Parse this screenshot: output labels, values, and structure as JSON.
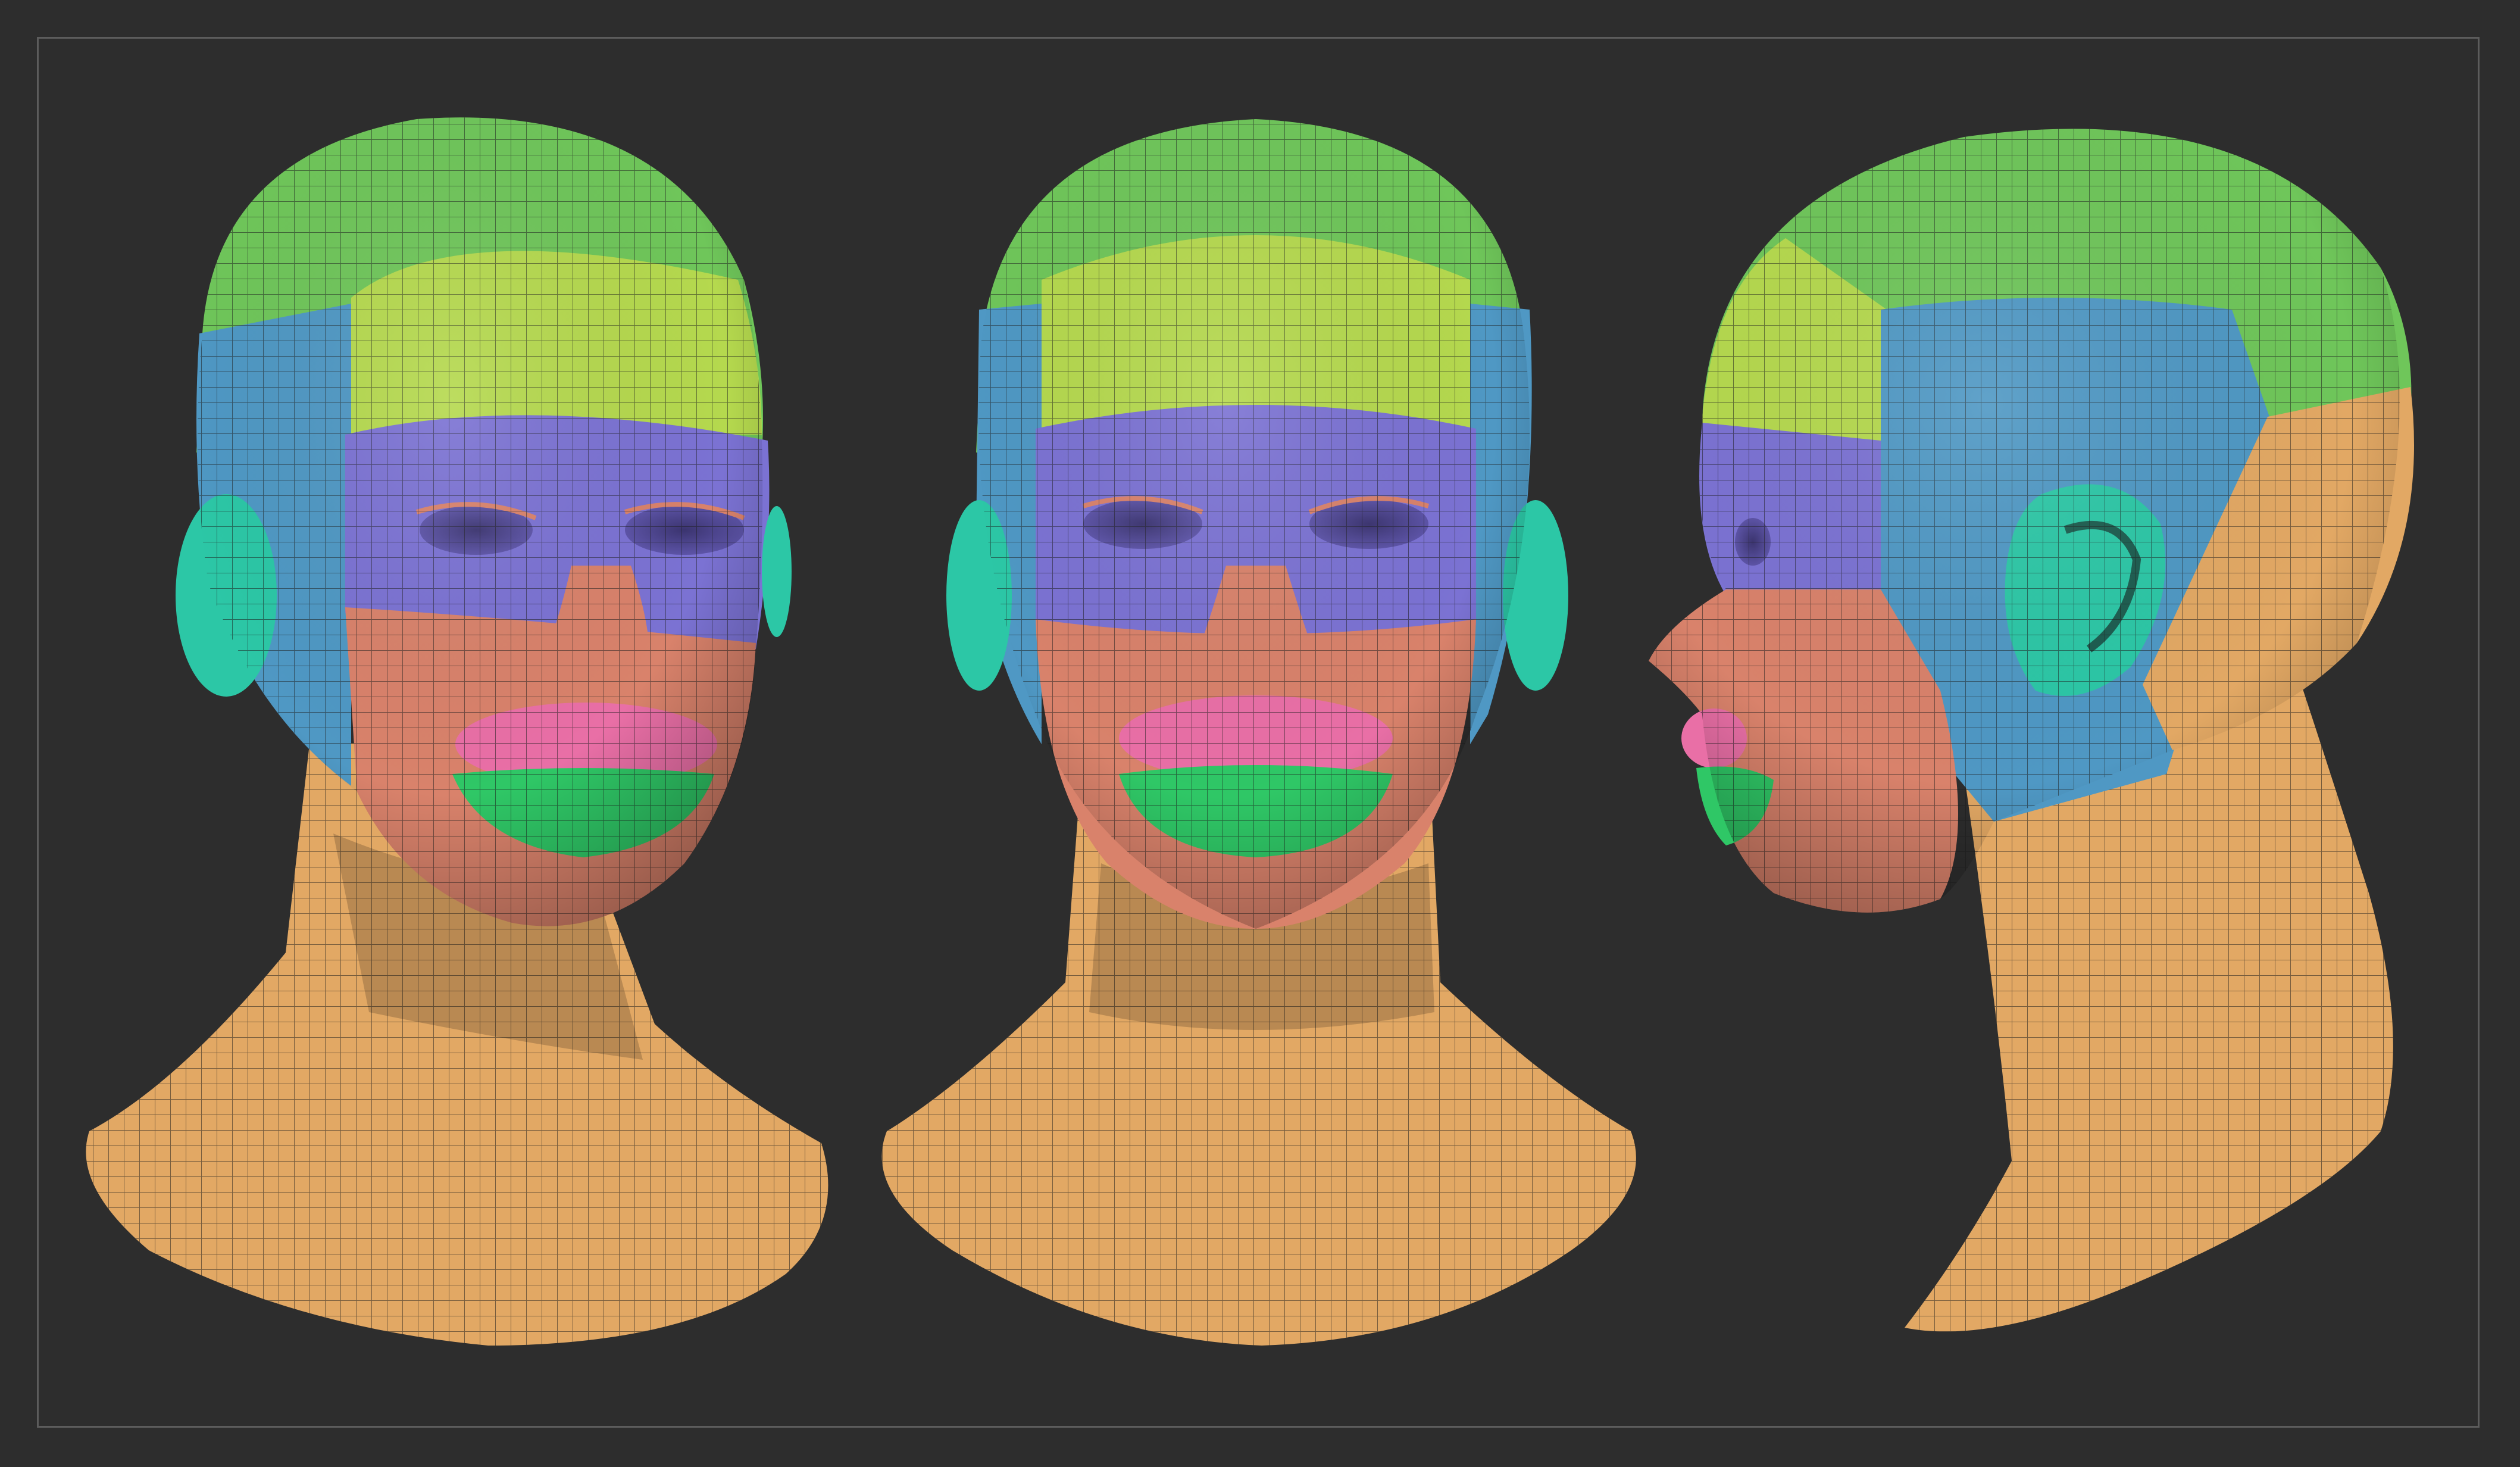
{
  "scene": {
    "background": "#2d2d2d",
    "frame_color": "#5c5c5c",
    "views": [
      {
        "id": "front-left-three-quarter",
        "description": ""
      },
      {
        "id": "front",
        "description": ""
      },
      {
        "id": "side-profile",
        "description": ""
      }
    ],
    "polygroup_colors": {
      "crown": "#6fc65a",
      "forehead": "#b5d94e",
      "temple_back": "#4f98c4",
      "eye_band": "#7b72d3",
      "cheek_nose": "#d9826b",
      "upper_lip": "#e96fa6",
      "lower_lip": "#2fc766",
      "ear": "#2cc7a6",
      "neck": "#e2a864",
      "wire": "#2a2a2a"
    }
  }
}
